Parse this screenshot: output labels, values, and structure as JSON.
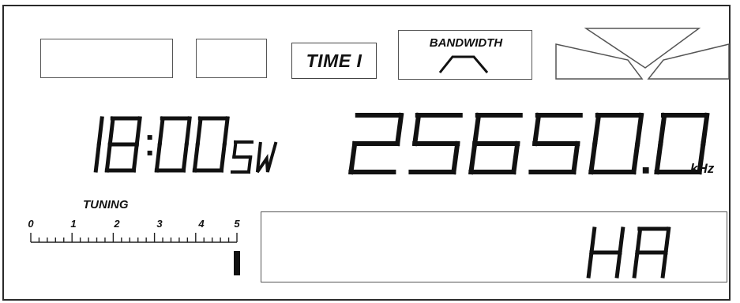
{
  "indicators": {
    "time_label": "TIME I",
    "bandwidth_label": "BANDWIDTH"
  },
  "display": {
    "clock": "18:00",
    "band": "SW",
    "frequency": "25650.0",
    "frequency_unit": "kHz",
    "text_area": "HA"
  },
  "tuning": {
    "label": "TUNING",
    "scale": [
      "0",
      "1",
      "2",
      "3",
      "4",
      "5"
    ],
    "level": 5
  }
}
